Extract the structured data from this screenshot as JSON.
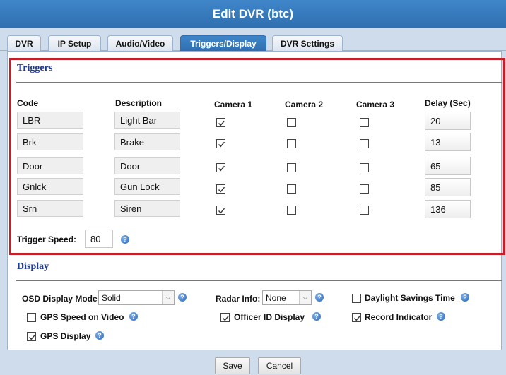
{
  "window": {
    "title": "Edit DVR (btc)"
  },
  "tabs": [
    "DVR",
    "IP Setup",
    "Audio/Video",
    "Triggers/Display",
    "DVR Settings"
  ],
  "active_tab": "Triggers/Display",
  "triggers": {
    "title": "Triggers",
    "headers": {
      "code": "Code",
      "description": "Description",
      "camera1": "Camera 1",
      "camera2": "Camera 2",
      "camera3": "Camera 3",
      "delay": "Delay (Sec)"
    },
    "rows": [
      {
        "code": "LBR",
        "description": "Light Bar",
        "camera1": true,
        "camera2": false,
        "camera3": false,
        "delay": "20"
      },
      {
        "code": "Brk",
        "description": "Brake",
        "camera1": true,
        "camera2": false,
        "camera3": false,
        "delay": "13"
      },
      {
        "code": "Door",
        "description": "Door",
        "camera1": true,
        "camera2": false,
        "camera3": false,
        "delay": "65"
      },
      {
        "code": "Gnlck",
        "description": "Gun Lock",
        "camera1": true,
        "camera2": false,
        "camera3": false,
        "delay": "85"
      },
      {
        "code": "Srn",
        "description": "Siren",
        "camera1": true,
        "camera2": false,
        "camera3": false,
        "delay": "136"
      }
    ],
    "trigger_speed_label": "Trigger Speed:",
    "trigger_speed_value": "80"
  },
  "display": {
    "title": "Display",
    "osd_mode_label": "OSD Display Mode",
    "osd_mode_value": "Solid",
    "radar_info_label": "Radar Info:",
    "radar_info_value": "None",
    "daylight_savings_label": "Daylight Savings Time",
    "daylight_savings_checked": false,
    "gps_speed_label": "GPS Speed on Video",
    "gps_speed_checked": false,
    "officer_id_label": "Officer ID Display",
    "officer_id_checked": true,
    "record_indicator_label": "Record Indicator",
    "record_indicator_checked": true,
    "gps_display_label": "GPS Display",
    "gps_display_checked": true
  },
  "buttons": {
    "save": "Save",
    "cancel": "Cancel"
  },
  "icons": {
    "help": "help-icon",
    "dropdown": "chevron-down-icon"
  },
  "colors": {
    "title_bar": "#2f6fb0",
    "highlight_box": "#c81e28",
    "section_title": "#1f3a93"
  }
}
